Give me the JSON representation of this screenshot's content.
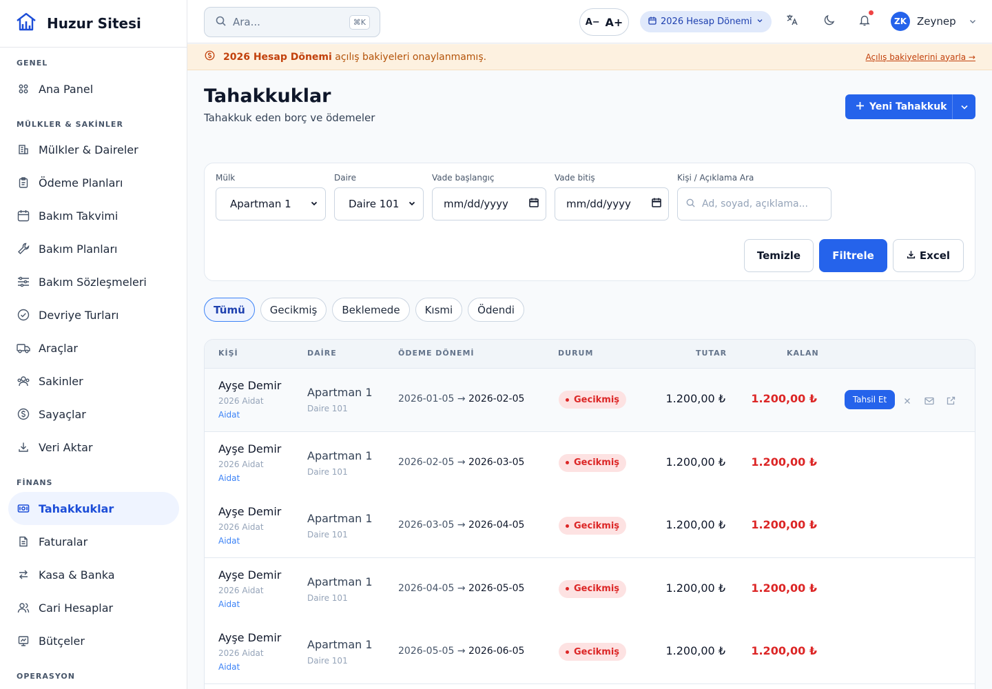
{
  "brand": {
    "name": "Huzur Sitesi"
  },
  "sidebar": {
    "sections": [
      {
        "title": "GENEL",
        "items": [
          {
            "label": "Ana Panel",
            "icon": "grid-icon"
          }
        ]
      },
      {
        "title": "MÜLKLER & SAKİNLER",
        "items": [
          {
            "label": "Mülkler & Daireler",
            "icon": "building-icon"
          },
          {
            "label": "Ödeme Planları",
            "icon": "clipboard-icon"
          },
          {
            "label": "Bakım Takvimi",
            "icon": "calendar-icon"
          },
          {
            "label": "Bakım Planları",
            "icon": "wrench-icon"
          },
          {
            "label": "Bakım Sözleşmeleri",
            "icon": "sliders-icon"
          },
          {
            "label": "Devriye Turları",
            "icon": "check-circle-icon"
          },
          {
            "label": "Araçlar",
            "icon": "truck-icon"
          },
          {
            "label": "Sakinler",
            "icon": "users-icon"
          },
          {
            "label": "Sayaçlar",
            "icon": "dollar-circle-icon"
          },
          {
            "label": "Veri Aktar",
            "icon": "download-icon"
          }
        ]
      },
      {
        "title": "FİNANS",
        "items": [
          {
            "label": "Tahakkuklar",
            "icon": "receipt-icon",
            "active": true
          },
          {
            "label": "Faturalar",
            "icon": "document-icon"
          },
          {
            "label": "Kasa & Banka",
            "icon": "transfer-icon"
          },
          {
            "label": "Cari Hesaplar",
            "icon": "user-group-icon"
          },
          {
            "label": "Bütçeler",
            "icon": "budget-icon"
          }
        ]
      },
      {
        "title": "OPERASYON",
        "items": []
      }
    ]
  },
  "topbar": {
    "search_placeholder": "Ara...",
    "search_shortcut": "⌘K",
    "font_decrease": "A−",
    "font_increase": "A+",
    "period": "2026 Hesap Dönemi",
    "user_initials": "ZK",
    "user_name": "Zeynep"
  },
  "banner": {
    "strong": "2026 Hesap Dönemi",
    "text": " açılış bakiyeleri onaylanmamış.",
    "link": "Açılış bakiyelerini ayarla →"
  },
  "page": {
    "title": "Tahakkuklar",
    "subtitle": "Tahakkuk eden borç ve ödemeler",
    "new_button": "Yeni Tahakkuk"
  },
  "filters": {
    "property_label": "Mülk",
    "property_value": "Apartman 1",
    "unit_label": "Daire",
    "unit_value": "Daire 101",
    "due_start_label": "Vade başlangıç",
    "due_start_value": "mm/dd/yyyy",
    "due_end_label": "Vade bitiş",
    "due_end_value": "mm/dd/yyyy",
    "search_label": "Kişi / Açıklama Ara",
    "search_placeholder": "Ad, soyad, açıklama...",
    "clear": "Temizle",
    "filter": "Filtrele",
    "excel": "Excel"
  },
  "tabs": [
    "Tümü",
    "Gecikmiş",
    "Beklemede",
    "Kısmi",
    "Ödendi"
  ],
  "table": {
    "headers": {
      "person": "KİŞİ",
      "unit": "DAİRE",
      "period": "ÖDEME DÖNEMİ",
      "status": "DURUM",
      "amount": "TUTAR",
      "remaining": "KALAN"
    },
    "action_label": "Tahsil Et",
    "rows": [
      {
        "name": "Ayşe Demir",
        "desc": "2026 Aidat",
        "category": "Aidat",
        "property": "Apartman 1",
        "unit": "Daire 101",
        "start": "2026-01-05",
        "end": "2026-02-05",
        "status": "Gecikmiş",
        "amount": "1.200,00 ₺",
        "remaining": "1.200,00 ₺"
      },
      {
        "name": "Ayşe Demir",
        "desc": "2026 Aidat",
        "category": "Aidat",
        "property": "Apartman 1",
        "unit": "Daire 101",
        "start": "2026-02-05",
        "end": "2026-03-05",
        "status": "Gecikmiş",
        "amount": "1.200,00 ₺",
        "remaining": "1.200,00 ₺"
      },
      {
        "name": "Ayşe Demir",
        "desc": "2026 Aidat",
        "category": "Aidat",
        "property": "Apartman 1",
        "unit": "Daire 101",
        "start": "2026-03-05",
        "end": "2026-04-05",
        "status": "Gecikmiş",
        "amount": "1.200,00 ₺",
        "remaining": "1.200,00 ₺"
      },
      {
        "name": "Ayşe Demir",
        "desc": "2026 Aidat",
        "category": "Aidat",
        "property": "Apartman 1",
        "unit": "Daire 101",
        "start": "2026-04-05",
        "end": "2026-05-05",
        "status": "Gecikmiş",
        "amount": "1.200,00 ₺",
        "remaining": "1.200,00 ₺"
      },
      {
        "name": "Ayşe Demir",
        "desc": "2026 Aidat",
        "category": "Aidat",
        "property": "Apartman 1",
        "unit": "Daire 101",
        "start": "2026-05-05",
        "end": "2026-06-05",
        "status": "Gecikmiş",
        "amount": "1.200,00 ₺",
        "remaining": "1.200,00 ₺"
      }
    ]
  },
  "colors": {
    "accent": "#2563eb",
    "danger": "#dc2626",
    "warning_bg": "#fdf1e0"
  }
}
